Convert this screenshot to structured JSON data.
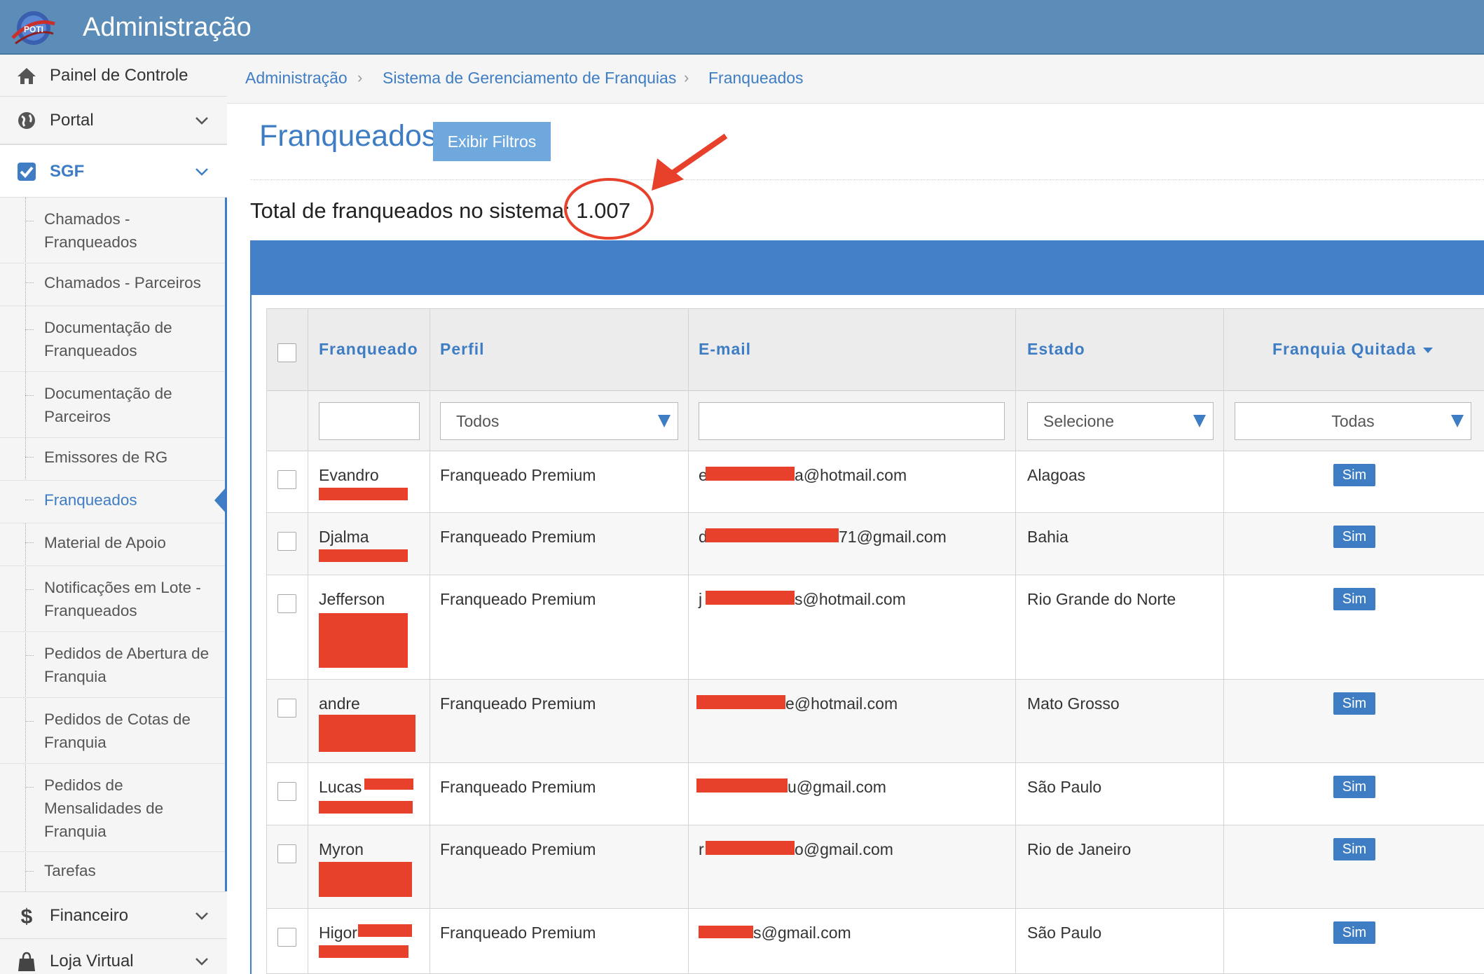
{
  "app": {
    "title": "Administração",
    "logo_text": "POTI"
  },
  "sidebar": {
    "items": [
      {
        "label": "Painel de Controle",
        "icon": "home-icon"
      },
      {
        "label": "Portal",
        "icon": "globe-icon"
      },
      {
        "label": "SGF",
        "icon": "checkbox-checked-icon"
      },
      {
        "label": "Financeiro",
        "icon": "dollar-icon"
      },
      {
        "label": "Loja Virtual",
        "icon": "shopping-bag-icon"
      }
    ],
    "sgf_items": [
      "Chamados - Franqueados",
      "Chamados - Parceiros",
      "Documentação de Franqueados",
      "Documentação de Parceiros",
      "Emissores de RG",
      "Franqueados",
      "Material de Apoio",
      "Notificações em Lote - Franqueados",
      "Pedidos de Abertura de Franquia",
      "Pedidos de Cotas de Franquia",
      "Pedidos de Mensalidades de Franquia",
      "Tarefas"
    ],
    "current": "Franqueados"
  },
  "breadcrumb": [
    "Administração",
    "Sistema de Gerenciamento de Franquias",
    "Franqueados"
  ],
  "page": {
    "title": "Franqueados",
    "filter_button": "Exibir Filtros",
    "total_label": "Total de franqueados no sistema: ",
    "total_value": "1.007"
  },
  "table": {
    "columns": [
      "Franqueado",
      "Perfil",
      "E-mail",
      "Estado",
      "Franquia Quitada"
    ],
    "filters": {
      "perfil": "Todos",
      "estado": "Selecione",
      "quitada": "Todas"
    },
    "rows": [
      {
        "name": "Evandro",
        "perfil": "Franqueado Premium",
        "email_prefix": "e",
        "email_suffix": "a@hotmail.com",
        "estado": "Alagoas",
        "quitada": "Sim"
      },
      {
        "name": "Djalma",
        "perfil": "Franqueado Premium",
        "email_prefix": "d",
        "email_suffix": "71@gmail.com",
        "estado": "Bahia",
        "quitada": "Sim"
      },
      {
        "name": "Jefferson",
        "perfil": "Franqueado Premium",
        "email_prefix": "j",
        "email_suffix": "s@hotmail.com",
        "estado": "Rio Grande do Norte",
        "quitada": "Sim"
      },
      {
        "name": "andre",
        "perfil": "Franqueado Premium",
        "email_prefix": "",
        "email_suffix": "e@hotmail.com",
        "estado": "Mato Grosso",
        "quitada": "Sim"
      },
      {
        "name": "Lucas",
        "perfil": "Franqueado Premium",
        "email_prefix": "",
        "email_suffix": "u@gmail.com",
        "estado": "São Paulo",
        "quitada": "Sim"
      },
      {
        "name": "Myron",
        "perfil": "Franqueado Premium",
        "email_prefix": "r",
        "email_suffix": "o@gmail.com",
        "estado": "Rio de Janeiro",
        "quitada": "Sim"
      },
      {
        "name": "Higor",
        "perfil": "Franqueado Premium",
        "email_prefix": "",
        "email_suffix": "s@gmail.com",
        "estado": "São Paulo",
        "quitada": "Sim"
      }
    ]
  },
  "colors": {
    "topbar": "#5b8db8",
    "accent": "#3e7dc4",
    "band": "#4380c7",
    "annotation": "#e8412b",
    "redaction": "#e8412b"
  }
}
